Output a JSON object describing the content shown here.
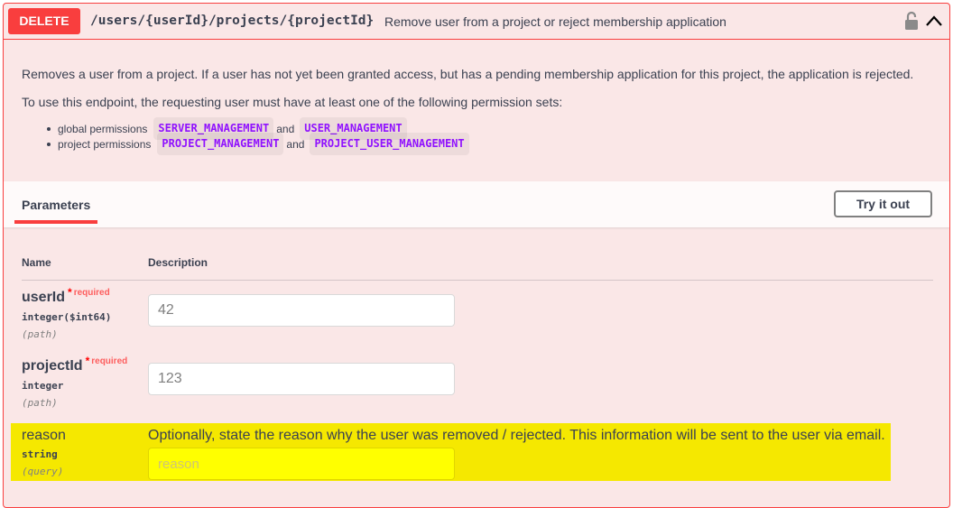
{
  "summary": {
    "method": "DELETE",
    "path": "/users/{userId}/projects/{projectId}",
    "description": "Remove user from a project or reject membership application",
    "lock_icon": "lock-icon",
    "collapse_icon": "chevron-up-icon"
  },
  "description": {
    "line1": "Removes a user from a project. If a user has not yet been granted access, but has a pending membership application for this project, the application is rejected.",
    "line2": "To use this endpoint, the requesting user must have at least one of the following permission sets:",
    "permissions": [
      {
        "label": "global permissions",
        "first": "SERVER_MANAGEMENT",
        "and": "and",
        "second": "USER_MANAGEMENT"
      },
      {
        "label": "project permissions",
        "first": "PROJECT_MANAGEMENT",
        "and": "and",
        "second": "PROJECT_USER_MANAGEMENT"
      }
    ]
  },
  "params_header": {
    "tab": "Parameters",
    "try_button": "Try it out"
  },
  "table": {
    "col_name": "Name",
    "col_description": "Description"
  },
  "params": [
    {
      "name": "userId",
      "star": "*",
      "required": "required",
      "type": "integer($int64)",
      "in": "(path)",
      "value": "42"
    },
    {
      "name": "projectId",
      "star": "*",
      "required": "required",
      "type": "integer",
      "in": "(path)",
      "value": "123"
    },
    {
      "name": "reason",
      "type": "string",
      "in": "(query)",
      "description": "Optionally, state the reason why the user was removed / rejected. This information will be sent to the user via email.",
      "placeholder": "reason"
    }
  ],
  "colors": {
    "delete": "#f93e3e",
    "block_bg": "#fae7e7",
    "code": "#9012fe",
    "highlight": "#f5e800"
  }
}
